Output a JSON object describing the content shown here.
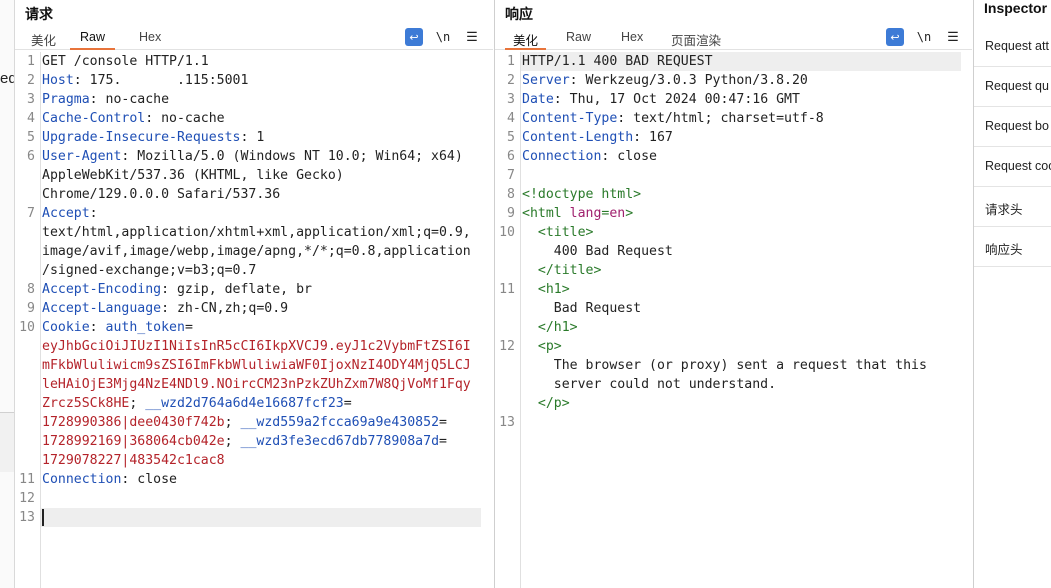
{
  "request": {
    "title": "请求",
    "tabs": [
      "美化",
      "Raw",
      "Hex"
    ],
    "active_tab": "Raw",
    "lines": [
      {
        "n": "1",
        "segs": [
          {
            "c": "v",
            "t": "GET /console HTTP/1.1"
          }
        ]
      },
      {
        "n": "2",
        "segs": [
          {
            "c": "k",
            "t": "Host"
          },
          {
            "c": "v",
            "t": ": 175.       .115:5001"
          }
        ]
      },
      {
        "n": "3",
        "segs": [
          {
            "c": "k",
            "t": "Pragma"
          },
          {
            "c": "v",
            "t": ": no-cache"
          }
        ]
      },
      {
        "n": "4",
        "segs": [
          {
            "c": "k",
            "t": "Cache-Control"
          },
          {
            "c": "v",
            "t": ": no-cache"
          }
        ]
      },
      {
        "n": "5",
        "segs": [
          {
            "c": "k",
            "t": "Upgrade-Insecure-Requests"
          },
          {
            "c": "v",
            "t": ": 1"
          }
        ]
      },
      {
        "n": "6",
        "segs": [
          {
            "c": "k",
            "t": "User-Agent"
          },
          {
            "c": "v",
            "t": ": Mozilla/5.0 (Windows NT 10.0; Win64; x64)"
          }
        ]
      },
      {
        "n": "",
        "segs": [
          {
            "c": "v",
            "t": "AppleWebKit/537.36 (KHTML, like Gecko)"
          }
        ]
      },
      {
        "n": "",
        "segs": [
          {
            "c": "v",
            "t": "Chrome/129.0.0.0 Safari/537.36"
          }
        ]
      },
      {
        "n": "7",
        "segs": [
          {
            "c": "k",
            "t": "Accept"
          },
          {
            "c": "v",
            "t": ":"
          }
        ]
      },
      {
        "n": "",
        "segs": [
          {
            "c": "v",
            "t": "text/html,application/xhtml+xml,application/xml;q=0.9,"
          }
        ]
      },
      {
        "n": "",
        "segs": [
          {
            "c": "v",
            "t": "image/avif,image/webp,image/apng,*/*;q=0.8,application"
          }
        ]
      },
      {
        "n": "",
        "segs": [
          {
            "c": "v",
            "t": "/signed-exchange;v=b3;q=0.7"
          }
        ]
      },
      {
        "n": "8",
        "segs": [
          {
            "c": "k",
            "t": "Accept-Encoding"
          },
          {
            "c": "v",
            "t": ": gzip, deflate, br"
          }
        ]
      },
      {
        "n": "9",
        "segs": [
          {
            "c": "k",
            "t": "Accept-Language"
          },
          {
            "c": "v",
            "t": ": zh-CN,zh;q=0.9"
          }
        ]
      },
      {
        "n": "10",
        "segs": [
          {
            "c": "k",
            "t": "Cookie"
          },
          {
            "c": "v",
            "t": ": "
          },
          {
            "c": "blue",
            "t": "auth_token"
          },
          {
            "c": "v",
            "t": "="
          }
        ]
      },
      {
        "n": "",
        "segs": [
          {
            "c": "red",
            "t": "eyJhbGciOiJIUzI1NiIsInR5cCI6IkpXVCJ9.eyJ1c2VybmFtZSI6I"
          }
        ]
      },
      {
        "n": "",
        "segs": [
          {
            "c": "red",
            "t": "mFkbWluliwicm9sZSI6ImFkbWluliwiaWF0IjoxNzI4ODY4MjQ5LCJ"
          }
        ]
      },
      {
        "n": "",
        "segs": [
          {
            "c": "red",
            "t": "leHAiOjE3Mjg4NzE4NDl9.NOircCM23nPzkZUhZxm7W8QjVoMf1Fqy"
          }
        ]
      },
      {
        "n": "",
        "segs": [
          {
            "c": "red",
            "t": "Zrcz5SCk8HE"
          },
          {
            "c": "v",
            "t": "; "
          },
          {
            "c": "blue",
            "t": "__wzd2d764a6d4e16687fcf23"
          },
          {
            "c": "v",
            "t": "="
          }
        ]
      },
      {
        "n": "",
        "segs": [
          {
            "c": "red",
            "t": "1728990386|dee0430f742b"
          },
          {
            "c": "v",
            "t": "; "
          },
          {
            "c": "blue",
            "t": "__wzd559a2fcca69a9e430852"
          },
          {
            "c": "v",
            "t": "="
          }
        ]
      },
      {
        "n": "",
        "segs": [
          {
            "c": "red",
            "t": "1728992169|368064cb042e"
          },
          {
            "c": "v",
            "t": "; "
          },
          {
            "c": "blue",
            "t": "__wzd3fe3ecd67db778908a7d"
          },
          {
            "c": "v",
            "t": "="
          }
        ]
      },
      {
        "n": "",
        "segs": [
          {
            "c": "red",
            "t": "1729078227|483542c1cac8"
          }
        ]
      },
      {
        "n": "11",
        "segs": [
          {
            "c": "k",
            "t": "Connection"
          },
          {
            "c": "v",
            "t": ": close"
          }
        ]
      },
      {
        "n": "12",
        "segs": []
      },
      {
        "n": "13",
        "segs": [],
        "current": true
      }
    ]
  },
  "response": {
    "title": "响应",
    "tabs": [
      "美化",
      "Raw",
      "Hex",
      "页面渲染"
    ],
    "active_tab": "美化",
    "lines": [
      {
        "n": "1",
        "segs": [
          {
            "c": "v",
            "t": "HTTP/1.1 400 BAD REQUEST"
          }
        ],
        "current": true
      },
      {
        "n": "2",
        "segs": [
          {
            "c": "k",
            "t": "Server"
          },
          {
            "c": "v",
            "t": ": Werkzeug/3.0.3 Python/3.8.20"
          }
        ]
      },
      {
        "n": "3",
        "segs": [
          {
            "c": "k",
            "t": "Date"
          },
          {
            "c": "v",
            "t": ": Thu, 17 Oct 2024 00:47:16 GMT"
          }
        ]
      },
      {
        "n": "4",
        "segs": [
          {
            "c": "k",
            "t": "Content-Type"
          },
          {
            "c": "v",
            "t": ": text/html; charset=utf-8"
          }
        ]
      },
      {
        "n": "5",
        "segs": [
          {
            "c": "k",
            "t": "Content-Length"
          },
          {
            "c": "v",
            "t": ": 167"
          }
        ]
      },
      {
        "n": "6",
        "segs": [
          {
            "c": "k",
            "t": "Connection"
          },
          {
            "c": "v",
            "t": ": close"
          }
        ]
      },
      {
        "n": "7",
        "segs": []
      },
      {
        "n": "8",
        "segs": [
          {
            "c": "tag",
            "t": "<!doctype html>"
          }
        ]
      },
      {
        "n": "9",
        "segs": [
          {
            "c": "tag",
            "t": "<html "
          },
          {
            "c": "attr",
            "t": "lang"
          },
          {
            "c": "tag",
            "t": "="
          },
          {
            "c": "attr",
            "t": "en"
          },
          {
            "c": "tag",
            "t": ">"
          }
        ]
      },
      {
        "n": "10",
        "segs": [
          {
            "c": "tag",
            "t": "  <title>"
          }
        ]
      },
      {
        "n": "",
        "segs": [
          {
            "c": "v",
            "t": "    400 Bad Request"
          }
        ]
      },
      {
        "n": "",
        "segs": [
          {
            "c": "tag",
            "t": "  </title>"
          }
        ]
      },
      {
        "n": "11",
        "segs": [
          {
            "c": "tag",
            "t": "  <h1>"
          }
        ]
      },
      {
        "n": "",
        "segs": [
          {
            "c": "v",
            "t": "    Bad Request"
          }
        ]
      },
      {
        "n": "",
        "segs": [
          {
            "c": "tag",
            "t": "  </h1>"
          }
        ]
      },
      {
        "n": "12",
        "segs": [
          {
            "c": "tag",
            "t": "  <p>"
          }
        ]
      },
      {
        "n": "",
        "segs": [
          {
            "c": "v",
            "t": "    The browser (or proxy) sent a request that this"
          }
        ]
      },
      {
        "n": "",
        "segs": [
          {
            "c": "v",
            "t": "    server could not understand."
          }
        ]
      },
      {
        "n": "",
        "segs": [
          {
            "c": "tag",
            "t": "  </p>"
          }
        ]
      },
      {
        "n": "13",
        "segs": []
      }
    ]
  },
  "inspector": {
    "title": "Inspector",
    "items": [
      "Request att",
      "Request qu",
      "Request bo",
      "Request coo",
      "请求头",
      "响应头"
    ]
  },
  "left_edge_glyph": "eq"
}
